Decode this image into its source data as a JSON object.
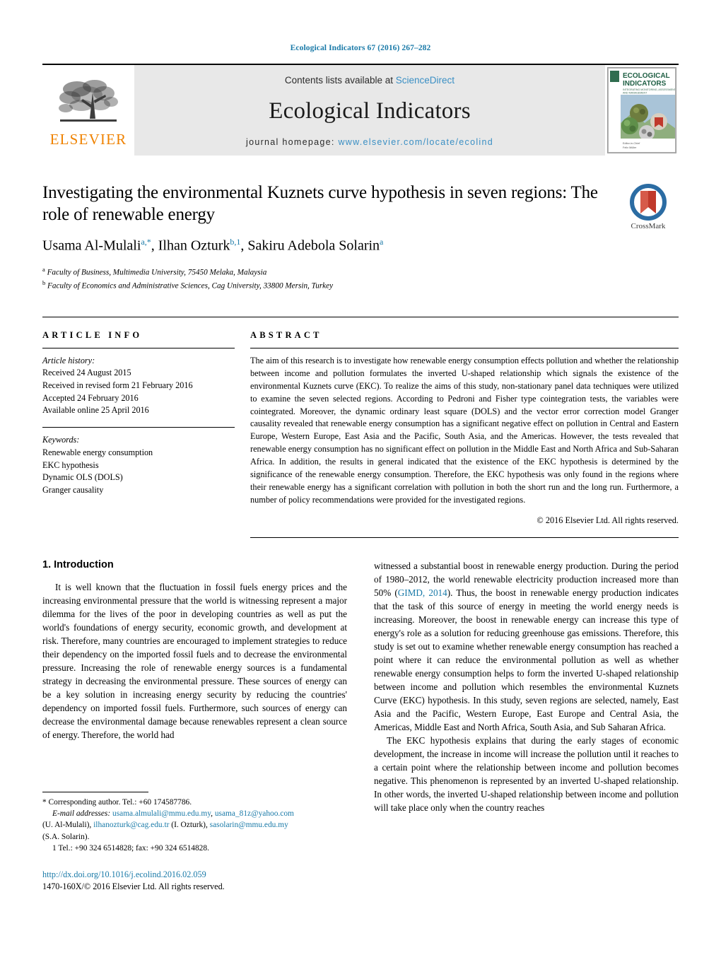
{
  "running_head": "Ecological Indicators 67 (2016) 267–282",
  "masthead": {
    "publisher_logo_label": "ELSEVIER",
    "contents_prefix": "Contents lists available at",
    "contents_link": "ScienceDirect",
    "journal_title": "Ecological Indicators",
    "homepage_prefix": "journal homepage:",
    "homepage_url": "www.elsevier.com/locate/ecolind",
    "cover": {
      "line1": "ECOLOGICAL",
      "line2": "INDICATORS",
      "subtitle": "INTEGRATING MONITORING, ASSESSMENT AND MANAGEMENT",
      "footer1": "Editor-in-Chief",
      "footer2": "Felix Müller"
    }
  },
  "article": {
    "title": "Investigating the environmental Kuznets curve hypothesis in seven regions: The role of renewable energy",
    "authors_html": "Usama Al-Mulali<sup>a,*</sup>, Ilhan Ozturk<sup>b,1</sup>, Sakiru Adebola Solarin<sup>a</sup>",
    "affiliations": [
      {
        "marker": "a",
        "text": "Faculty of Business, Multimedia University, 75450 Melaka, Malaysia"
      },
      {
        "marker": "b",
        "text": "Faculty of Economics and Administrative Sciences, Cag University, 33800 Mersin, Turkey"
      }
    ],
    "crossmark_label": "CrossMark"
  },
  "article_info": {
    "heading": "ARTICLE INFO",
    "history_title": "Article history:",
    "history": [
      "Received 24 August 2015",
      "Received in revised form 21 February 2016",
      "Accepted 24 February 2016",
      "Available online 25 April 2016"
    ],
    "keywords_title": "Keywords:",
    "keywords": [
      "Renewable energy consumption",
      "EKC hypothesis",
      "Dynamic OLS (DOLS)",
      "Granger causality"
    ]
  },
  "abstract": {
    "heading": "ABSTRACT",
    "text": "The aim of this research is to investigate how renewable energy consumption effects pollution and whether the relationship between income and pollution formulates the inverted U-shaped relationship which signals the existence of the environmental Kuznets curve (EKC). To realize the aims of this study, non-stationary panel data techniques were utilized to examine the seven selected regions. According to Pedroni and Fisher type cointegration tests, the variables were cointegrated. Moreover, the dynamic ordinary least square (DOLS) and the vector error correction model Granger causality revealed that renewable energy consumption has a significant negative effect on pollution in Central and Eastern Europe, Western Europe, East Asia and the Pacific, South Asia, and the Americas. However, the tests revealed that renewable energy consumption has no significant effect on pollution in the Middle East and North Africa and Sub-Saharan Africa. In addition, the results in general indicated that the existence of the EKC hypothesis is determined by the significance of the renewable energy consumption. Therefore, the EKC hypothesis was only found in the regions where their renewable energy has a significant correlation with pollution in both the short run and the long run. Furthermore, a number of policy recommendations were provided for the investigated regions.",
    "copyright": "© 2016 Elsevier Ltd. All rights reserved."
  },
  "body": {
    "section_number_title": "1.  Introduction",
    "left_paragraph": "It is well known that the fluctuation in fossil fuels energy prices and the increasing environmental pressure that the world is witnessing represent a major dilemma for the lives of the poor in developing countries as well as put the world's foundations of energy security, economic growth, and development at risk. Therefore, many countries are encouraged to implement strategies to reduce their dependency on the imported fossil fuels and to decrease the environmental pressure. Increasing the role of renewable energy sources is a fundamental strategy in decreasing the environmental pressure. These sources of energy can be a key solution in increasing energy security by reducing the countries' dependency on imported fossil fuels. Furthermore, such sources of energy can decrease the environmental damage because renewables represent a clean source of energy. Therefore, the world had",
    "right_paragraph_1_pre": "witnessed a substantial boost in renewable energy production. During the period of 1980–2012, the world renewable electricity production increased more than 50% (",
    "right_paragraph_1_cite": "GIMD, 2014",
    "right_paragraph_1_post": "). Thus, the boost in renewable energy production indicates that the task of this source of energy in meeting the world energy needs is increasing. Moreover, the boost in renewable energy can increase this type of energy's role as a solution for reducing greenhouse gas emissions. Therefore, this study is set out to examine whether renewable energy consumption has reached a point where it can reduce the environmental pollution as well as whether renewable energy consumption helps to form the inverted U-shaped relationship between income and pollution which resembles the environmental Kuznets Curve (EKC) hypothesis. In this study, seven regions are selected, namely, East Asia and the Pacific, Western Europe, East Europe and Central Asia, the Americas, Middle East and North Africa, South Asia, and Sub Saharan Africa.",
    "right_paragraph_2": "The EKC hypothesis explains that during the early stages of economic development, the increase in income will increase the pollution until it reaches to a certain point where the relationship between income and pollution becomes negative. This phenomenon is represented by an inverted U-shaped relationship. In other words, the inverted U-shaped relationship between income and pollution will take place only when the country reaches"
  },
  "footnotes": {
    "corresponding": "*  Corresponding author. Tel.: +60 174587786.",
    "email_label": "E-mail addresses:",
    "emails": [
      {
        "address": "usama.almulali@mmu.edu.my",
        "sep": ", "
      },
      {
        "address": "usama_81z@yahoo.com",
        "sep": ""
      }
    ],
    "email_line2_owner": "(U. Al-Mulali), ",
    "email2": "ilhanozturk@cag.edu.tr",
    "email2_owner": " (I. Ozturk), ",
    "email3": "sasolarin@mmu.edu.my",
    "email3_owner": "(S.A. Solarin).",
    "tel_note": "1  Tel.: +90 324 6514828; fax: +90 324 6514828."
  },
  "doi_block": {
    "doi": "http://dx.doi.org/10.1016/j.ecolind.2016.02.059",
    "issn_line": "1470-160X/© 2016 Elsevier Ltd. All rights reserved."
  },
  "colors": {
    "link_blue": "#1a7aa8",
    "elsevier_orange": "#ef8200",
    "mast_grey": "#e8e8e8"
  }
}
